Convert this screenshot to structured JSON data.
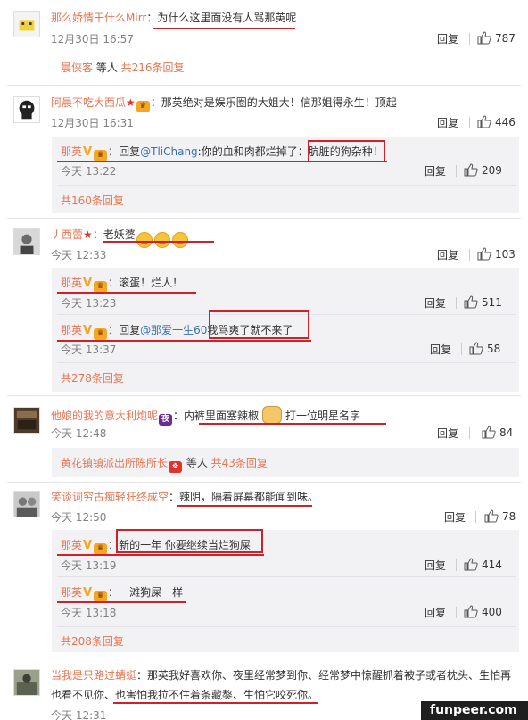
{
  "actions": {
    "reply": "回复"
  },
  "c1": {
    "user": "那么娇情干什么Mirr",
    "text": "为什么这里面没有人骂那英呢",
    "time": "12月30日 16:57",
    "likes": "787",
    "more_user": "晨侠客",
    "more_mid": " 等人 ",
    "more_count": "共216条回复"
  },
  "c2": {
    "user": "阿晨不吃大西瓜",
    "text": "那英绝对是娱乐圈的大姐大！信那姐得永生！顶起",
    "time": "12月30日 16:31",
    "likes": "446",
    "r1": {
      "user": "那英",
      "pre": "回复",
      "mention": "@TliChang",
      "text": ":你的血和肉都烂掉了：",
      "boxed": "肮脏的狗杂种！",
      "time": "今天 13:22",
      "likes": "209"
    },
    "more": "共160条回复"
  },
  "c3": {
    "user": "丿西蕾",
    "text": "老妖婆",
    "time": "今天 12:33",
    "likes": "103",
    "r1": {
      "user": "那英",
      "text": "滚蛋！烂人！",
      "time": "今天 13:23",
      "likes": "511"
    },
    "r2": {
      "user": "那英",
      "pre": "回复",
      "mention": "@那爱一生60",
      "boxed": "我骂爽了就不来了",
      "time": "今天 13:37",
      "likes": "58"
    },
    "more": "共278条回复"
  },
  "c4": {
    "user": "他娘的我的意大利炮呢",
    "text_a": "内裤里面塞辣椒",
    "text_b": "打一位明星名字",
    "time": "今天 12:48",
    "likes": "84",
    "more_user": "黄花镇镇派出所陈所长",
    "more_mid": " 等人 ",
    "more_count": "共43条回复"
  },
  "c5": {
    "user": "笑谈词穷古痴轻狂终成空",
    "text": "辣阴，隔着屏幕都能闻到味。",
    "time": "今天 12:50",
    "likes": "78",
    "r1": {
      "user": "那英",
      "boxed": "新的一年 你要继续当烂狗屎",
      "time": "今天 13:19",
      "likes": "414"
    },
    "r2": {
      "user": "那英",
      "text": "一滩狗屎一样",
      "time": "今天 13:18",
      "likes": "400"
    },
    "more": "共208条回复"
  },
  "c6": {
    "user": "当我是只路过蜻蜓",
    "text_line1": "那英我好喜欢你、夜里经常梦到你、经常梦中惊醒抓着被子或者枕头、生怕再",
    "text_line2a": "也看不见你、",
    "text_line2b": "也害怕我拉不住着条藏獒、生怕它咬死你。",
    "time": "今天 12:31"
  },
  "watermark": "funpeer.com",
  "icons": {
    "like": "thumbs-up-icon",
    "verified": "verified-v-icon",
    "crown": "crown-badge-icon",
    "star": "star-icon",
    "emoji": "laughing-emoji-icon",
    "doge": "doge-emoji-icon"
  },
  "colors": {
    "username": "#eb7350",
    "mention": "#3a6fb0",
    "highlight": "#d0202a",
    "nested_bg": "#f2f2f5"
  }
}
